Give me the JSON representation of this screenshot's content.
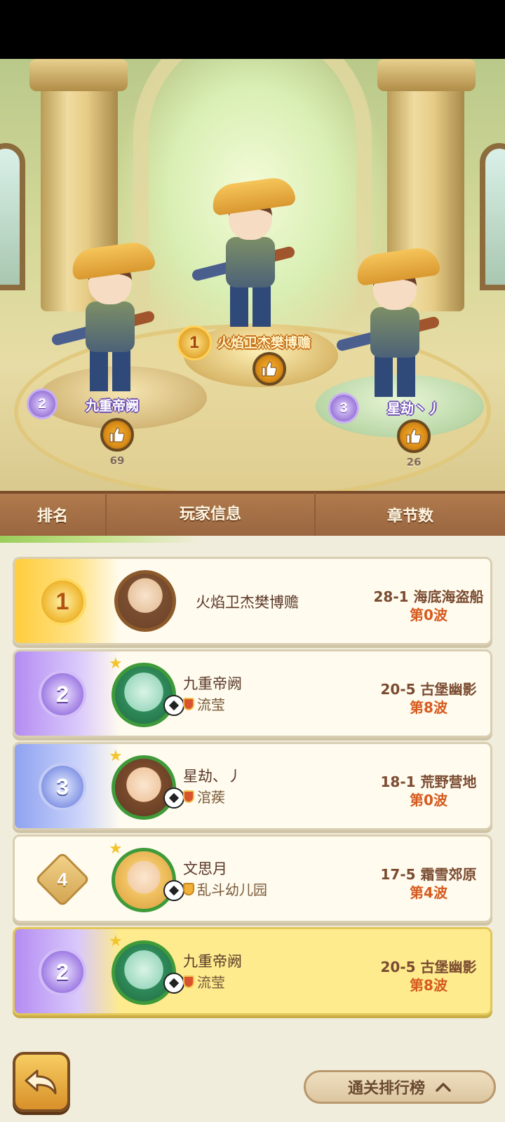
{
  "podium": {
    "first": {
      "rank": "1",
      "name": "火焰卫杰樊博赡"
    },
    "second": {
      "rank": "2",
      "name": "九重帝阙",
      "likes": "69"
    },
    "third": {
      "rank": "3",
      "name": "星劫丶丿",
      "likes": "26"
    }
  },
  "table_header": {
    "rank": "排名",
    "info": "玩家信息",
    "chapter": "章节数"
  },
  "rows": [
    {
      "rank": "1",
      "name": "火焰卫杰樊博赡",
      "guild": "",
      "chapter": "28-1 海底海盗船",
      "wave": "第0波"
    },
    {
      "rank": "2",
      "name": "九重帝阙",
      "guild": "流莹",
      "chapter": "20-5 古堡幽影",
      "wave": "第8波"
    },
    {
      "rank": "3",
      "name": "星劫、丿",
      "guild": "涫蒺",
      "chapter": "18-1 荒野营地",
      "wave": "第0波"
    },
    {
      "rank": "4",
      "name": "文思月",
      "guild": "乱斗幼儿园",
      "chapter": "17-5 霜雪郊原",
      "wave": "第4波"
    }
  ],
  "my_row": {
    "rank": "2",
    "name": "九重帝阙",
    "guild": "流莹",
    "chapter": "20-5 古堡幽影",
    "wave": "第8波"
  },
  "bottom": {
    "toggle_label": "通关排行榜"
  },
  "icons": {
    "like": "thumbs-up-icon",
    "back": "back-arrow-icon",
    "collapse": "chevron-up-icon",
    "ball": "soccer-ball-icon",
    "guild": "guild-badge-icon"
  },
  "colors": {
    "header_band": "#a06c44",
    "list_bg": "#f1eddc",
    "self_row": "#fdeb8e",
    "wave_text": "#d65a1e",
    "chapter_text": "#7a4b30"
  }
}
